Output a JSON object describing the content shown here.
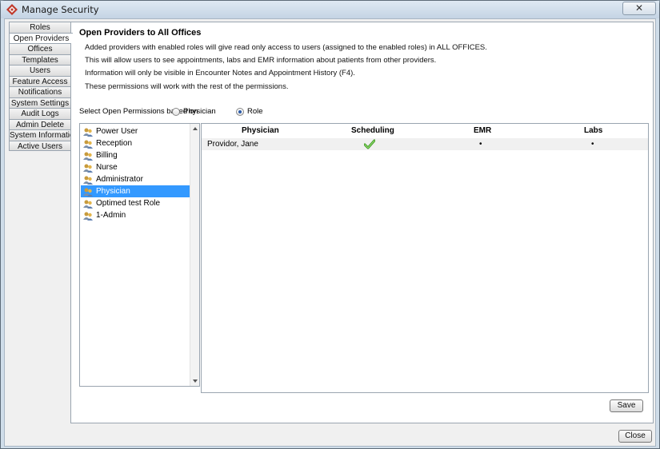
{
  "window": {
    "title": "Manage Security",
    "close_glyph": "✕",
    "icon": "app-logo-icon"
  },
  "sidebar": {
    "tabs": [
      {
        "label": "Roles"
      },
      {
        "label": "Open Providers",
        "active": true
      },
      {
        "label": "Offices"
      },
      {
        "label": "Templates"
      },
      {
        "label": "Users"
      },
      {
        "label": "Feature Access"
      },
      {
        "label": "Notifications"
      },
      {
        "label": "System Settings"
      },
      {
        "label": "Audit Logs"
      },
      {
        "label": "Admin Delete"
      },
      {
        "label": "System Information"
      },
      {
        "label": "Active Users"
      }
    ]
  },
  "panel": {
    "title": "Open Providers to All Offices",
    "info": [
      "Added providers with enabled roles will give read only access to users (assigned to the enabled roles) in ALL OFFICES.",
      "This will allow users to see appointments, labs and EMR information about patients from other providers.",
      "Information will only be visible in Encounter Notes and Appointment History (F4).",
      "These permissions will work with the rest of the permissions."
    ],
    "selector": {
      "label": "Select Open Permissions  based on",
      "options": [
        {
          "label": "Physician",
          "checked": false
        },
        {
          "label": "Role",
          "checked": true
        }
      ]
    },
    "roles": [
      {
        "label": "Power User"
      },
      {
        "label": "Reception"
      },
      {
        "label": "Billing"
      },
      {
        "label": "Nurse"
      },
      {
        "label": "Administrator"
      },
      {
        "label": "Physician",
        "selected": true
      },
      {
        "label": "Optimed test Role"
      },
      {
        "label": "1-Admin"
      }
    ],
    "grid": {
      "columns": [
        "Physician",
        "Scheduling",
        "EMR",
        "Labs"
      ],
      "rows": [
        {
          "physician": "Providor, Jane",
          "scheduling": "check-icon",
          "emr": "•",
          "labs": "•"
        }
      ]
    },
    "save_label": "Save"
  },
  "footer": {
    "close_label": "Close"
  },
  "colors": {
    "selection": "#3399ff",
    "check": "#3c9a1f",
    "titlebar": "#c4d4e4"
  }
}
